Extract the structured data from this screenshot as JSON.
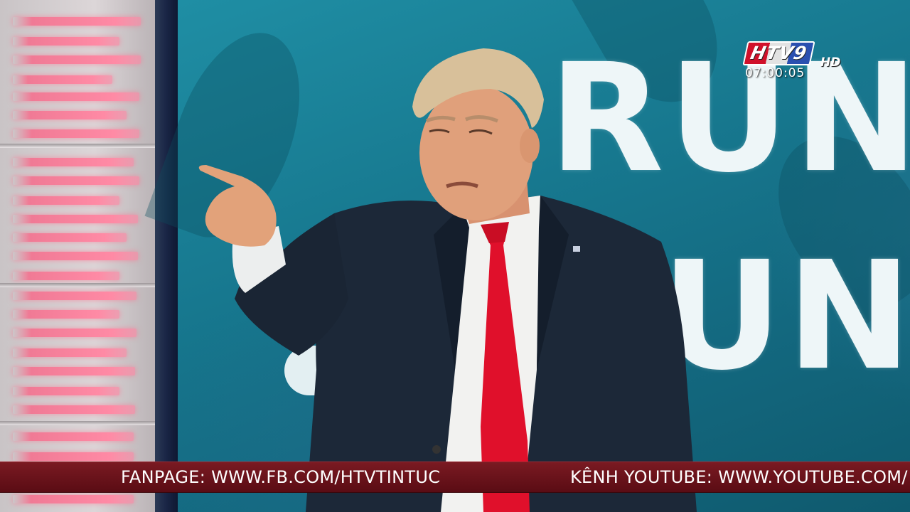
{
  "overlay": {
    "channel_logo": "HTV9",
    "channel_hd": "HD",
    "clock": "07:00:05"
  },
  "background_text": {
    "line1": "RUN",
    "line2": "UNT"
  },
  "ticker": {
    "item1": "FANPAGE: WWW.FB.COM/HTVTINTUC",
    "item2": "KÊNH YOUTUBE: WWW.YOUTUBE.COM/"
  },
  "colors": {
    "backdrop_teal": "#17788f",
    "ticker_red": "#6b121a",
    "tie_red": "#e0102b",
    "suit_navy": "#1c2838"
  }
}
